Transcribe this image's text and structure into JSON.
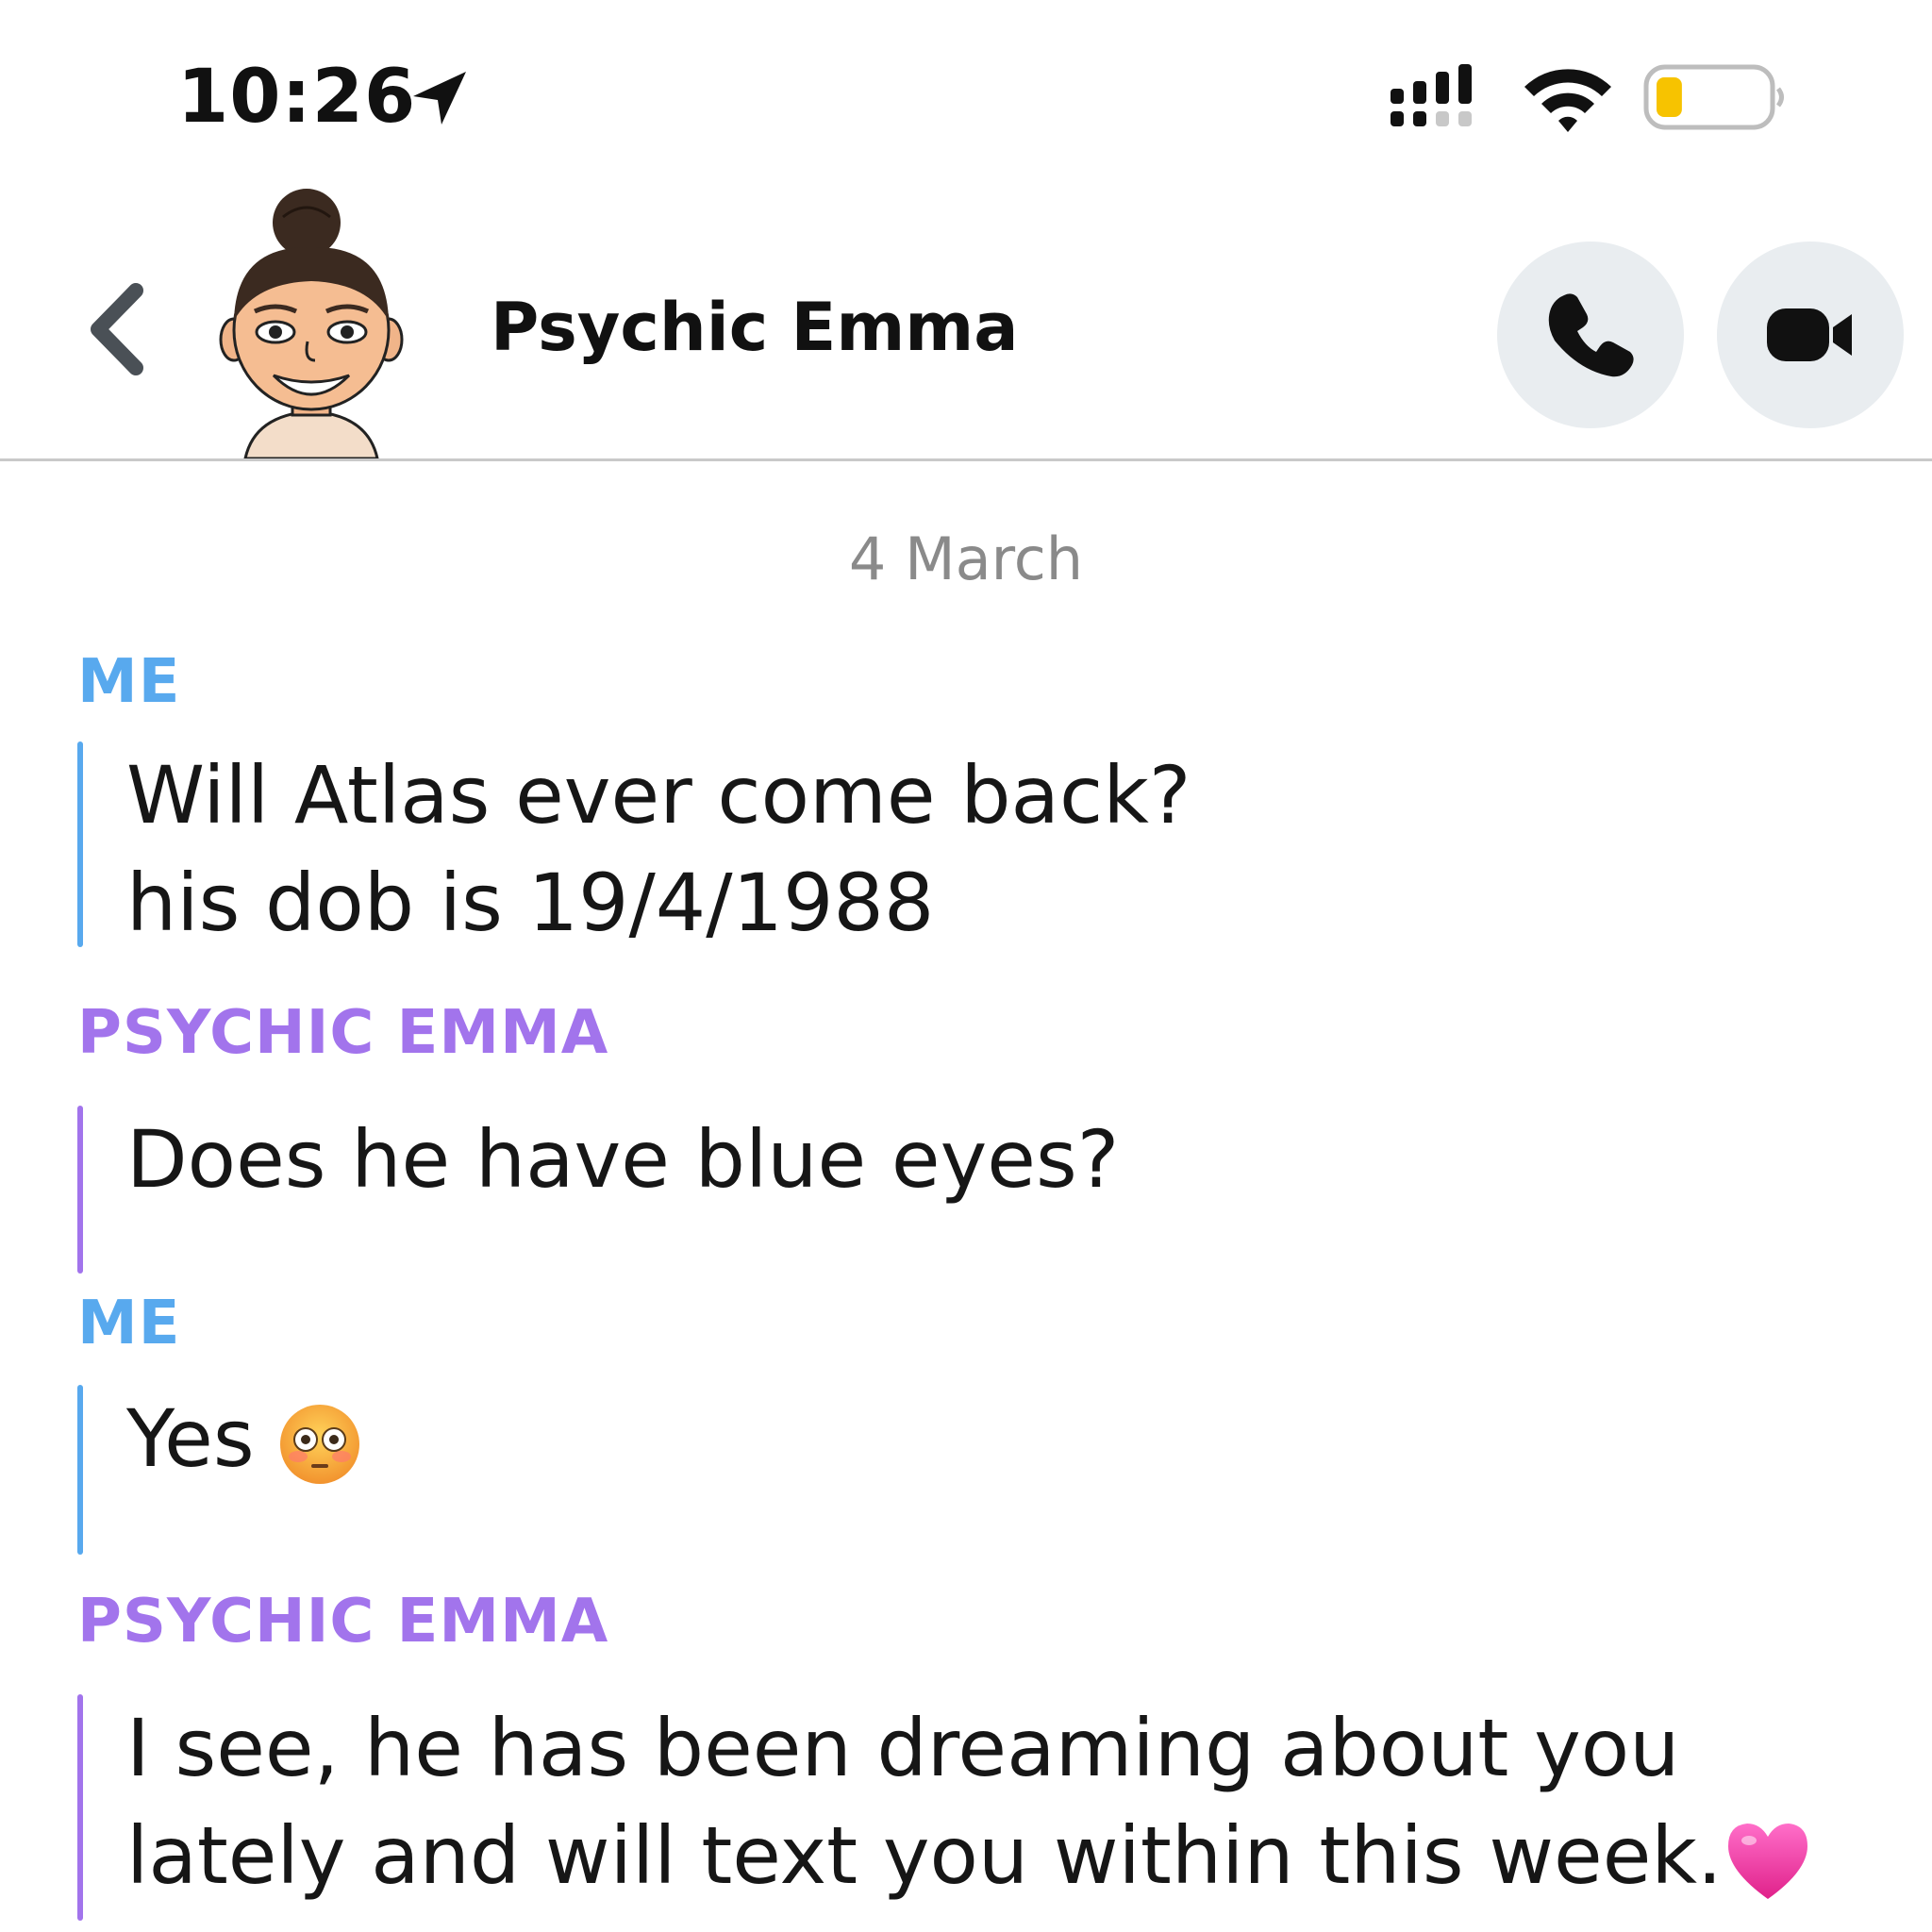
{
  "status_bar": {
    "time": "10:26",
    "battery_level": 0.15
  },
  "header": {
    "contact_name": "Psychic Emma"
  },
  "date_separator": "4 March",
  "messages": [
    {
      "sender": "ME",
      "lines": [
        "Will Atlas ever come back?",
        "his dob is 19/4/1988"
      ]
    },
    {
      "sender": "PSYCHIC EMMA",
      "lines": [
        "Does he have blue eyes?"
      ]
    },
    {
      "sender": "ME",
      "lines": [
        "Yes"
      ],
      "emoji": "flushed-face"
    },
    {
      "sender": "PSYCHIC EMMA",
      "lines": [
        "I see, he has been dreaming about you",
        "lately and will text you within this week."
      ],
      "emoji": "pink-heart"
    }
  ],
  "colors": {
    "me": "#58a9ee",
    "psychic_emma": "#a274ec",
    "battery": "#f7c300"
  }
}
